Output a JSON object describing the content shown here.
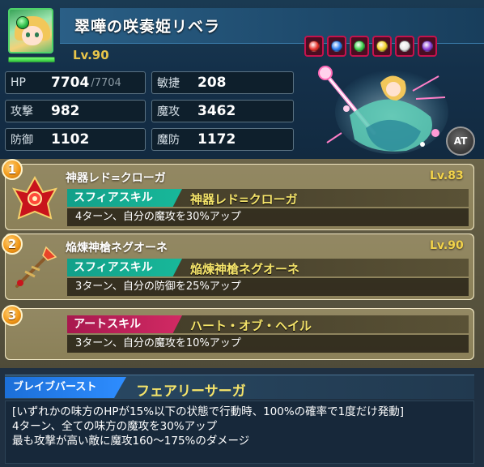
{
  "character": {
    "name": "翠嘩の咲奏姫リベラ",
    "level": "Lv.90",
    "element": "earth",
    "hp_fill": 1.0,
    "portrait_icon": "character-portrait",
    "art_icon": "character-full-art",
    "at_badge": "AT"
  },
  "orbs": [
    {
      "name": "fire-orb-icon",
      "color": "#e8302a"
    },
    {
      "name": "water-orb-icon",
      "color": "#2a7cf0"
    },
    {
      "name": "earth-orb-icon",
      "color": "#3ccf4a"
    },
    {
      "name": "thunder-orb-icon",
      "color": "#f5d22a"
    },
    {
      "name": "light-orb-icon",
      "color": "#e8e8e8"
    },
    {
      "name": "dark-orb-icon",
      "color": "#8a3cd8"
    }
  ],
  "stats": {
    "hp_label": "HP",
    "hp_value": "7704",
    "hp_max": "/7704",
    "agi_label": "敏捷",
    "agi_value": "208",
    "atk_label": "攻撃",
    "atk_value": "982",
    "matk_label": "魔攻",
    "matk_value": "3462",
    "def_label": "防御",
    "def_value": "1102",
    "mdef_label": "魔防",
    "mdef_value": "1172"
  },
  "skills": [
    {
      "number": "1",
      "name": "神器レド=クローガ",
      "level": "Lv.83",
      "tag": "スフィアスキル",
      "tag_title": "神器レド=クローガ",
      "description": "4ターン、自分の魔攻を30%アップ",
      "icon": "red-crown-icon"
    },
    {
      "number": "2",
      "name": "焔煉神槍ネグオーネ",
      "level": "Lv.90",
      "tag": "スフィアスキル",
      "tag_title": "焔煉神槍ネグオーネ",
      "description": "3ターン、自分の防御を25%アップ",
      "icon": "flame-spear-icon"
    },
    {
      "number": "3",
      "name": "",
      "level": "",
      "tag": "アートスキル",
      "tag_title": "ハート・オブ・ヘイル",
      "description": "3ターン、自分の魔攻を10%アップ",
      "icon": ""
    }
  ],
  "brave_burst": {
    "tag": "ブレイブバースト",
    "title": "フェアリーサーガ",
    "lines": [
      "[いずれかの味方のHPが15%以下の状態で行動時、100%の確率で1度だけ発動]",
      "4ターン、全ての味方の魔攻を30%アップ",
      "最も攻撃が高い敵に魔攻160～175%のダメージ"
    ]
  },
  "colors": {
    "accent_gold": "#f5e46a",
    "sphere_teal": "#18b89a",
    "art_pink": "#d22a64",
    "brave_blue": "#2e8dff"
  }
}
